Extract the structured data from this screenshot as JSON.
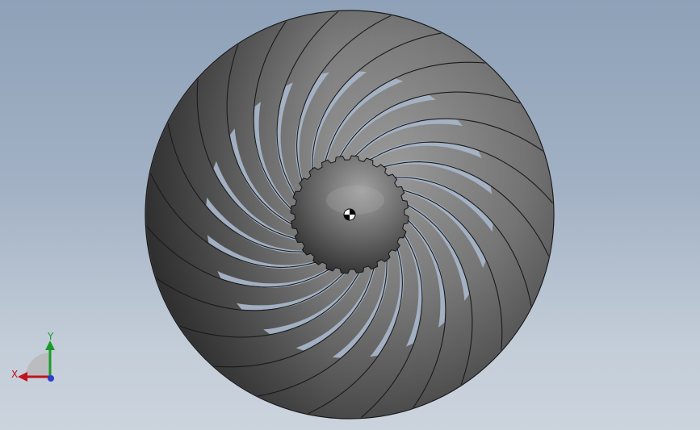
{
  "viewport": {
    "background_top": "#8ea1b8",
    "background_bottom": "#cbd3dd"
  },
  "model": {
    "object": "fan-impeller",
    "blade_count": 24,
    "body_color": "#7d7d7d",
    "shadow_color": "#3a3a3a",
    "gap_color": "#a5b4c7",
    "edge_color": "#1a1a1a"
  },
  "triad": {
    "x_label": "X",
    "y_label": "Y",
    "x_color": "#c0141e",
    "y_color": "#1b9a2a",
    "z_color": "#2b3fd0"
  }
}
